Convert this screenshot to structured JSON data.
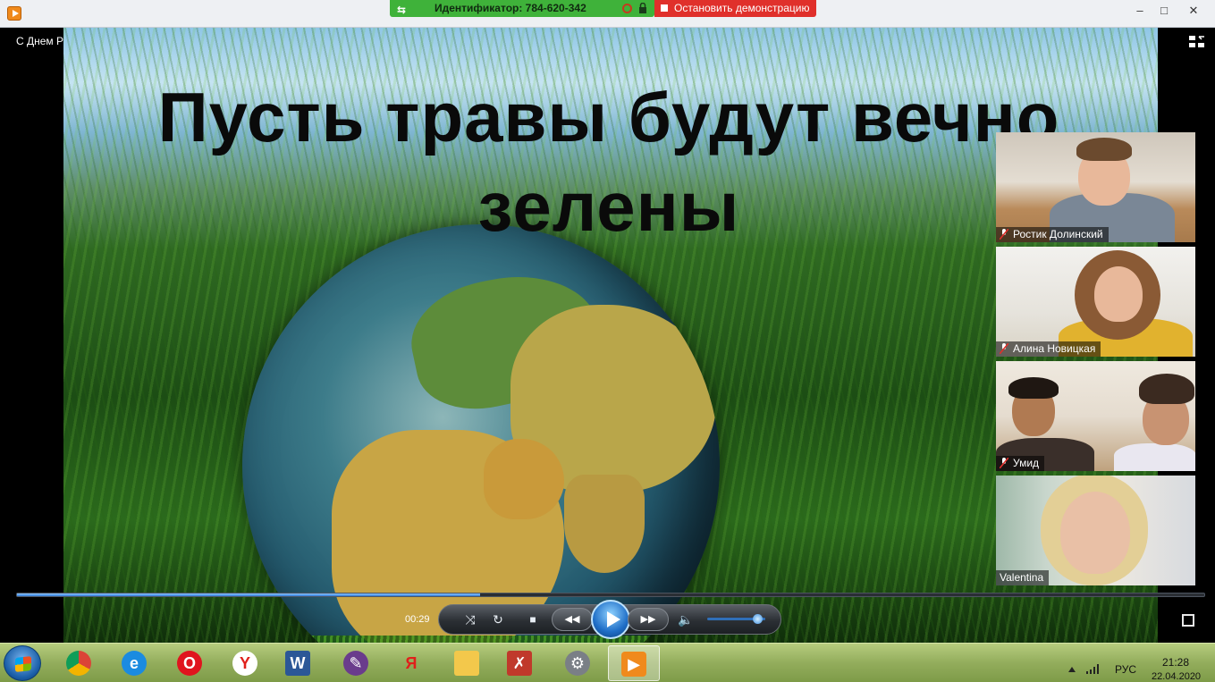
{
  "teamviewer": {
    "id_label": "Идентификатор: 784-620-342",
    "stop_label": "Остановить демонстрацию"
  },
  "window": {
    "minimize": "–",
    "maximize": "□",
    "close": "✕"
  },
  "player": {
    "media_title": "С Днем Рождения земля!",
    "slide_title": "Пусть травы будут вечно зелены",
    "current_time": "00:29",
    "progress": 0.39,
    "volume": 0.9
  },
  "participants": [
    {
      "name": "Ростик Долинский",
      "muted": true
    },
    {
      "name": "Алина Новицкая",
      "muted": true
    },
    {
      "name": "Умид",
      "muted": true
    },
    {
      "name": "Valentina",
      "muted": false
    }
  ],
  "controls": {
    "shuffle_glyph": "⤨",
    "repeat_glyph": "↻",
    "stop_glyph": "■",
    "prev_glyph": "◀◀",
    "next_glyph": "▶▶",
    "volume_glyph": "🔈"
  },
  "taskbar": {
    "apps": [
      "chrome",
      "internet-explorer",
      "opera",
      "yandex-browser",
      "word",
      "app-feather",
      "yandex",
      "file-explorer",
      "pdf-reader",
      "media-reel",
      "media-player"
    ],
    "yandex_glyph": "Я",
    "language": "РУС",
    "time": "21:28",
    "date": "22.04.2020"
  }
}
